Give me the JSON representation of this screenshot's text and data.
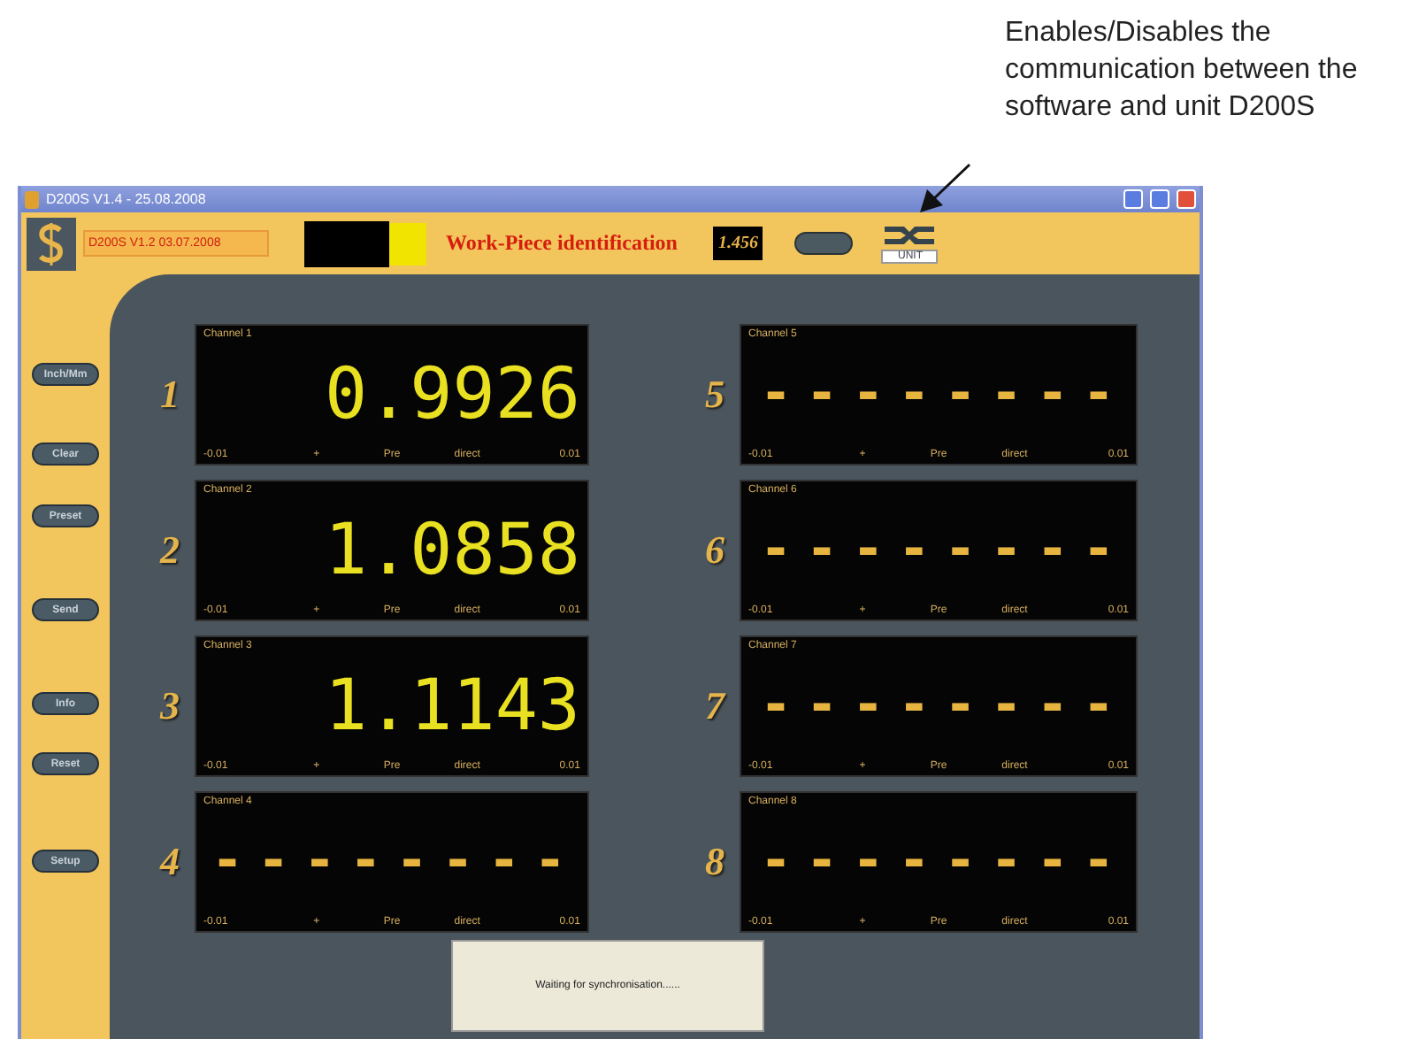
{
  "annotation": {
    "text": "Enables/Disables the communication between the software and unit D200S"
  },
  "window": {
    "title": "D200S V1.4 - 25.08.2008"
  },
  "header": {
    "version": "D200S V1.2 03.07.2008",
    "title": "Work-Piece identification",
    "reading": "1.456",
    "unit_label": "UNIT"
  },
  "sidebar": {
    "buttons": [
      "Inch/Mm",
      "Clear",
      "Preset",
      "Send",
      "Info",
      "Reset",
      "Setup"
    ]
  },
  "channels": [
    {
      "number": "1",
      "label": "Channel 1",
      "value": "0.9926",
      "scale": [
        "-0.01",
        "+",
        "Pre",
        "direct",
        "0.01"
      ]
    },
    {
      "number": "2",
      "label": "Channel 2",
      "value": "1.0858",
      "scale": [
        "-0.01",
        "+",
        "Pre",
        "direct",
        "0.01"
      ]
    },
    {
      "number": "3",
      "label": "Channel 3",
      "value": "1.1143",
      "scale": [
        "-0.01",
        "+",
        "Pre",
        "direct",
        "0.01"
      ]
    },
    {
      "number": "4",
      "label": "Channel 4",
      "value": "--------",
      "scale": [
        "-0.01",
        "+",
        "Pre",
        "direct",
        "0.01"
      ]
    },
    {
      "number": "5",
      "label": "Channel 5",
      "value": "--------",
      "scale": [
        "-0.01",
        "+",
        "Pre",
        "direct",
        "0.01"
      ]
    },
    {
      "number": "6",
      "label": "Channel 6",
      "value": "--------",
      "scale": [
        "-0.01",
        "+",
        "Pre",
        "direct",
        "0.01"
      ]
    },
    {
      "number": "7",
      "label": "Channel 7",
      "value": "--------",
      "scale": [
        "-0.01",
        "+",
        "Pre",
        "direct",
        "0.01"
      ]
    },
    {
      "number": "8",
      "label": "Channel 8",
      "value": "--------",
      "scale": [
        "-0.01",
        "+",
        "Pre",
        "direct",
        "0.01"
      ]
    }
  ],
  "dialog": {
    "message": "Waiting for synchronisation......"
  }
}
